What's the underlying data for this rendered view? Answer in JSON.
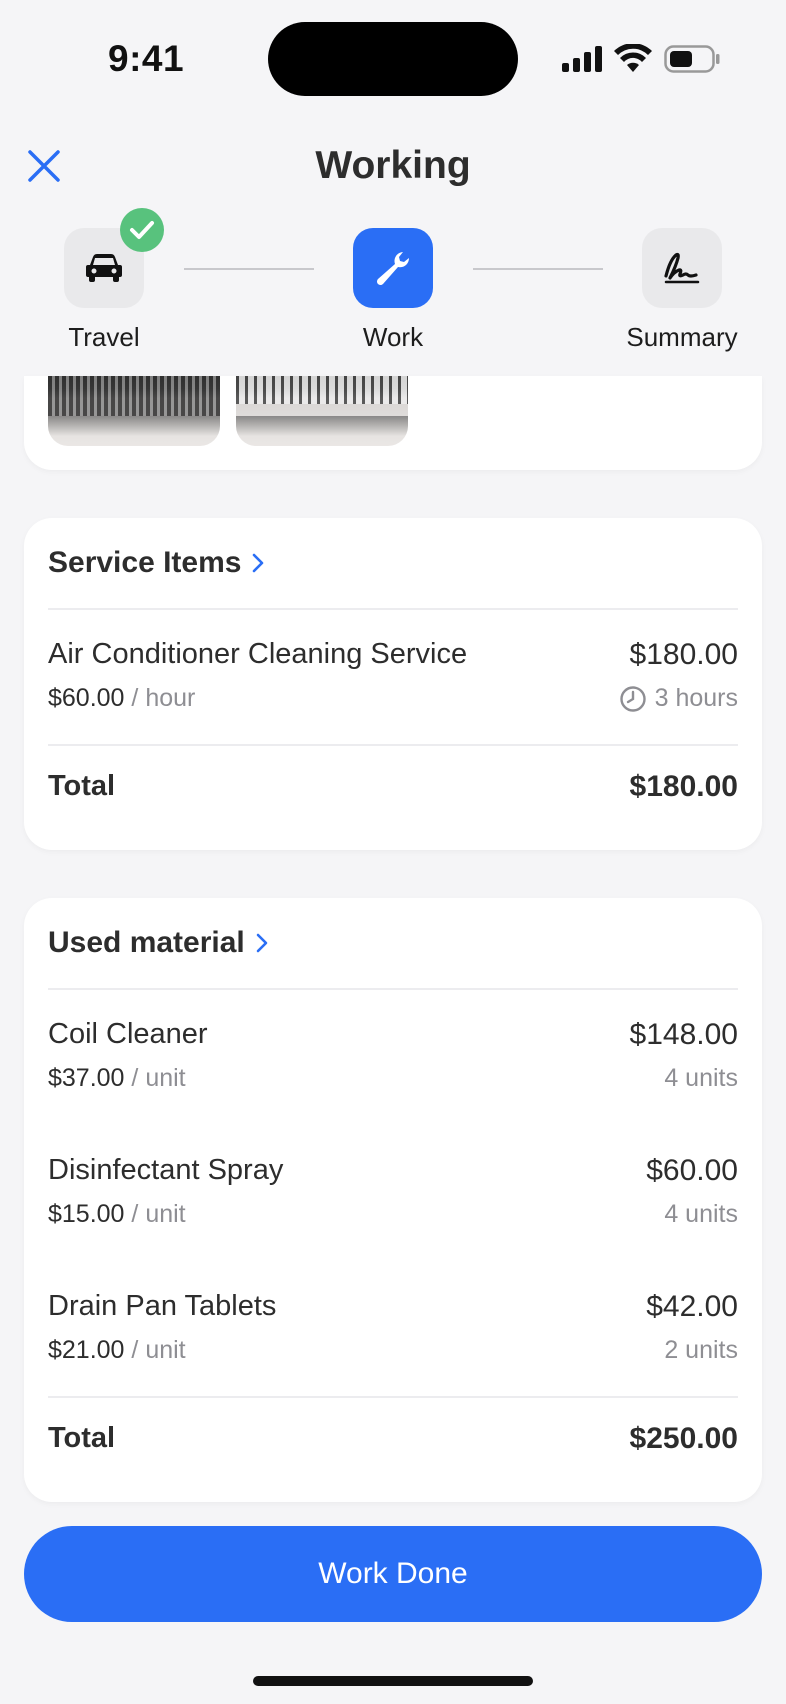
{
  "status_bar": {
    "time": "9:41"
  },
  "header": {
    "title": "Working"
  },
  "stepper": {
    "steps": [
      {
        "label": "Travel",
        "icon": "car-icon",
        "state": "completed"
      },
      {
        "label": "Work",
        "icon": "wrench-icon",
        "state": "active"
      },
      {
        "label": "Summary",
        "icon": "signature-icon",
        "state": "pending"
      }
    ]
  },
  "service_items": {
    "title": "Service Items",
    "items": [
      {
        "name": "Air Conditioner Cleaning Service",
        "price": "$180.00",
        "rate": "$60.00",
        "unit": "/ hour",
        "quantity": "3 hours"
      }
    ],
    "total_label": "Total",
    "total_value": "$180.00"
  },
  "used_material": {
    "title": "Used material",
    "items": [
      {
        "name": "Coil Cleaner",
        "price": "$148.00",
        "rate": "$37.00",
        "unit": "/ unit",
        "quantity": "4 units"
      },
      {
        "name": "Disinfectant Spray",
        "price": "$60.00",
        "rate": "$15.00",
        "unit": "/ unit",
        "quantity": "4 units"
      },
      {
        "name": "Drain Pan Tablets",
        "price": "$42.00",
        "rate": "$21.00",
        "unit": "/ unit",
        "quantity": "2 units"
      }
    ],
    "total_label": "Total",
    "total_value": "$250.00"
  },
  "actions": {
    "work_done_label": "Work Done"
  },
  "colors": {
    "accent": "#2a6ef5",
    "success": "#58c27d",
    "muted": "#8e8e93"
  }
}
